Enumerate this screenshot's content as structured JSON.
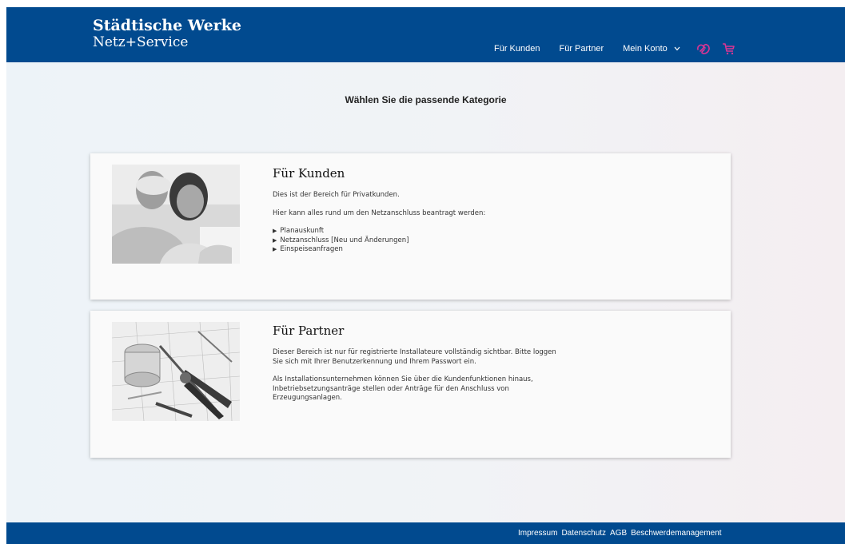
{
  "brand": {
    "line1": "Städtische Werke",
    "line2": "Netz+Service"
  },
  "nav": {
    "items": [
      {
        "label": "Für Kunden"
      },
      {
        "label": "Für Partner"
      }
    ],
    "account_label": "Mein Konto",
    "icons": [
      "handshake-icon",
      "cart-icon"
    ],
    "accent_color": "#d93594"
  },
  "page": {
    "heading": "Wählen Sie die passende Kategorie"
  },
  "cards": [
    {
      "title": "Für Kunden",
      "image": "couple-photo",
      "paragraphs": [
        "Dies ist der Bereich für Privatkunden.",
        "Hier kann alles rund um den Netzanschluss beantragt werden:"
      ],
      "bullets": [
        "Planauskunft",
        "Netzanschluss [Neu und Änderungen]",
        "Einspeiseanfragen"
      ]
    },
    {
      "title": "Für Partner",
      "image": "installation-tools-photo",
      "paragraphs": [
        "Dieser Bereich ist nur für registrierte Installateure vollständig sichtbar. Bitte loggen Sie sich mit Ihrer Benutzerkennung und Ihrem Passwort ein.",
        "Als Installationsunternehmen können Sie über die Kundenfunktionen hinaus, Inbetriebsetzungsanträge stellen oder Anträge für den Anschluss von Erzeugungsanlagen."
      ]
    }
  ],
  "footer": {
    "links": [
      "Impressum",
      "Datenschutz",
      "AGB",
      "Beschwerdemanagement"
    ]
  },
  "colors": {
    "brand_blue": "#014a8f",
    "accent": "#d93594"
  }
}
